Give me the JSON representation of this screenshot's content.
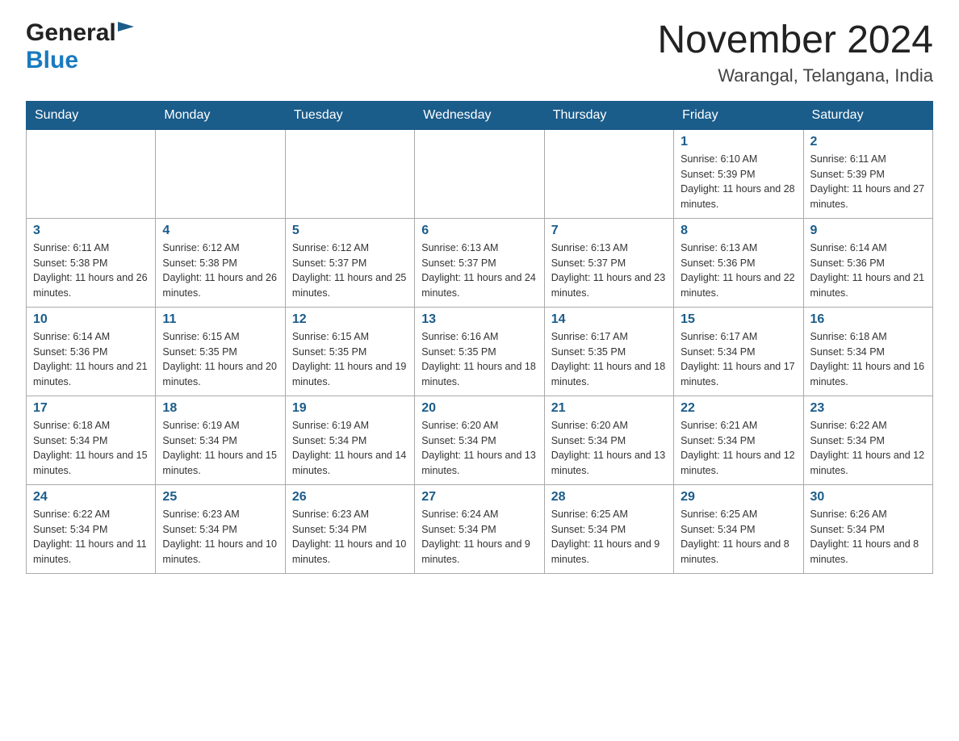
{
  "header": {
    "month_title": "November 2024",
    "location": "Warangal, Telangana, India",
    "logo_general": "General",
    "logo_blue": "Blue"
  },
  "weekdays": [
    "Sunday",
    "Monday",
    "Tuesday",
    "Wednesday",
    "Thursday",
    "Friday",
    "Saturday"
  ],
  "weeks": [
    [
      {
        "day": "",
        "sunrise": "",
        "sunset": "",
        "daylight": ""
      },
      {
        "day": "",
        "sunrise": "",
        "sunset": "",
        "daylight": ""
      },
      {
        "day": "",
        "sunrise": "",
        "sunset": "",
        "daylight": ""
      },
      {
        "day": "",
        "sunrise": "",
        "sunset": "",
        "daylight": ""
      },
      {
        "day": "",
        "sunrise": "",
        "sunset": "",
        "daylight": ""
      },
      {
        "day": "1",
        "sunrise": "Sunrise: 6:10 AM",
        "sunset": "Sunset: 5:39 PM",
        "daylight": "Daylight: 11 hours and 28 minutes."
      },
      {
        "day": "2",
        "sunrise": "Sunrise: 6:11 AM",
        "sunset": "Sunset: 5:39 PM",
        "daylight": "Daylight: 11 hours and 27 minutes."
      }
    ],
    [
      {
        "day": "3",
        "sunrise": "Sunrise: 6:11 AM",
        "sunset": "Sunset: 5:38 PM",
        "daylight": "Daylight: 11 hours and 26 minutes."
      },
      {
        "day": "4",
        "sunrise": "Sunrise: 6:12 AM",
        "sunset": "Sunset: 5:38 PM",
        "daylight": "Daylight: 11 hours and 26 minutes."
      },
      {
        "day": "5",
        "sunrise": "Sunrise: 6:12 AM",
        "sunset": "Sunset: 5:37 PM",
        "daylight": "Daylight: 11 hours and 25 minutes."
      },
      {
        "day": "6",
        "sunrise": "Sunrise: 6:13 AM",
        "sunset": "Sunset: 5:37 PM",
        "daylight": "Daylight: 11 hours and 24 minutes."
      },
      {
        "day": "7",
        "sunrise": "Sunrise: 6:13 AM",
        "sunset": "Sunset: 5:37 PM",
        "daylight": "Daylight: 11 hours and 23 minutes."
      },
      {
        "day": "8",
        "sunrise": "Sunrise: 6:13 AM",
        "sunset": "Sunset: 5:36 PM",
        "daylight": "Daylight: 11 hours and 22 minutes."
      },
      {
        "day": "9",
        "sunrise": "Sunrise: 6:14 AM",
        "sunset": "Sunset: 5:36 PM",
        "daylight": "Daylight: 11 hours and 21 minutes."
      }
    ],
    [
      {
        "day": "10",
        "sunrise": "Sunrise: 6:14 AM",
        "sunset": "Sunset: 5:36 PM",
        "daylight": "Daylight: 11 hours and 21 minutes."
      },
      {
        "day": "11",
        "sunrise": "Sunrise: 6:15 AM",
        "sunset": "Sunset: 5:35 PM",
        "daylight": "Daylight: 11 hours and 20 minutes."
      },
      {
        "day": "12",
        "sunrise": "Sunrise: 6:15 AM",
        "sunset": "Sunset: 5:35 PM",
        "daylight": "Daylight: 11 hours and 19 minutes."
      },
      {
        "day": "13",
        "sunrise": "Sunrise: 6:16 AM",
        "sunset": "Sunset: 5:35 PM",
        "daylight": "Daylight: 11 hours and 18 minutes."
      },
      {
        "day": "14",
        "sunrise": "Sunrise: 6:17 AM",
        "sunset": "Sunset: 5:35 PM",
        "daylight": "Daylight: 11 hours and 18 minutes."
      },
      {
        "day": "15",
        "sunrise": "Sunrise: 6:17 AM",
        "sunset": "Sunset: 5:34 PM",
        "daylight": "Daylight: 11 hours and 17 minutes."
      },
      {
        "day": "16",
        "sunrise": "Sunrise: 6:18 AM",
        "sunset": "Sunset: 5:34 PM",
        "daylight": "Daylight: 11 hours and 16 minutes."
      }
    ],
    [
      {
        "day": "17",
        "sunrise": "Sunrise: 6:18 AM",
        "sunset": "Sunset: 5:34 PM",
        "daylight": "Daylight: 11 hours and 15 minutes."
      },
      {
        "day": "18",
        "sunrise": "Sunrise: 6:19 AM",
        "sunset": "Sunset: 5:34 PM",
        "daylight": "Daylight: 11 hours and 15 minutes."
      },
      {
        "day": "19",
        "sunrise": "Sunrise: 6:19 AM",
        "sunset": "Sunset: 5:34 PM",
        "daylight": "Daylight: 11 hours and 14 minutes."
      },
      {
        "day": "20",
        "sunrise": "Sunrise: 6:20 AM",
        "sunset": "Sunset: 5:34 PM",
        "daylight": "Daylight: 11 hours and 13 minutes."
      },
      {
        "day": "21",
        "sunrise": "Sunrise: 6:20 AM",
        "sunset": "Sunset: 5:34 PM",
        "daylight": "Daylight: 11 hours and 13 minutes."
      },
      {
        "day": "22",
        "sunrise": "Sunrise: 6:21 AM",
        "sunset": "Sunset: 5:34 PM",
        "daylight": "Daylight: 11 hours and 12 minutes."
      },
      {
        "day": "23",
        "sunrise": "Sunrise: 6:22 AM",
        "sunset": "Sunset: 5:34 PM",
        "daylight": "Daylight: 11 hours and 12 minutes."
      }
    ],
    [
      {
        "day": "24",
        "sunrise": "Sunrise: 6:22 AM",
        "sunset": "Sunset: 5:34 PM",
        "daylight": "Daylight: 11 hours and 11 minutes."
      },
      {
        "day": "25",
        "sunrise": "Sunrise: 6:23 AM",
        "sunset": "Sunset: 5:34 PM",
        "daylight": "Daylight: 11 hours and 10 minutes."
      },
      {
        "day": "26",
        "sunrise": "Sunrise: 6:23 AM",
        "sunset": "Sunset: 5:34 PM",
        "daylight": "Daylight: 11 hours and 10 minutes."
      },
      {
        "day": "27",
        "sunrise": "Sunrise: 6:24 AM",
        "sunset": "Sunset: 5:34 PM",
        "daylight": "Daylight: 11 hours and 9 minutes."
      },
      {
        "day": "28",
        "sunrise": "Sunrise: 6:25 AM",
        "sunset": "Sunset: 5:34 PM",
        "daylight": "Daylight: 11 hours and 9 minutes."
      },
      {
        "day": "29",
        "sunrise": "Sunrise: 6:25 AM",
        "sunset": "Sunset: 5:34 PM",
        "daylight": "Daylight: 11 hours and 8 minutes."
      },
      {
        "day": "30",
        "sunrise": "Sunrise: 6:26 AM",
        "sunset": "Sunset: 5:34 PM",
        "daylight": "Daylight: 11 hours and 8 minutes."
      }
    ]
  ]
}
